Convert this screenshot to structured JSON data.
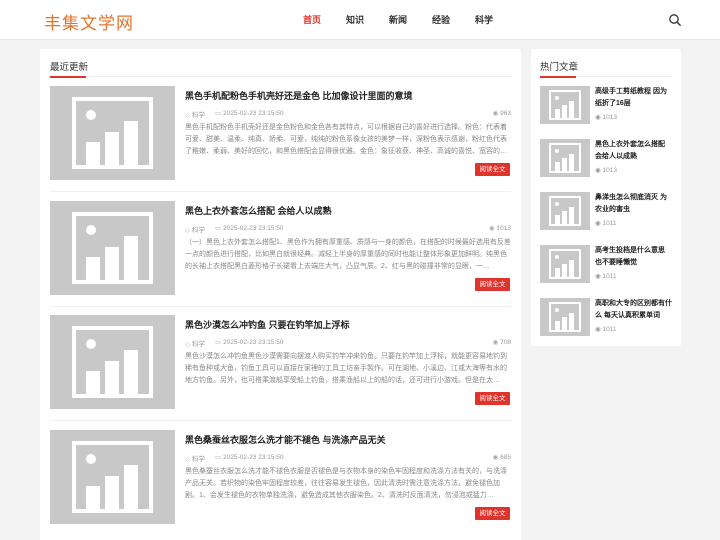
{
  "site": {
    "logo": "丰集文学网"
  },
  "nav": {
    "items": [
      "首页",
      "知识",
      "新闻",
      "经验",
      "科学"
    ],
    "active_index": 0
  },
  "colors": {
    "accent": "#e0332c",
    "logo": "#e2742c"
  },
  "main": {
    "section_title": "最近更新",
    "read_label": "阅读全文",
    "articles": [
      {
        "title": "黑色手机配粉色手机壳好还是金色 比加像设计里面的意境",
        "category": "科学",
        "date": "2025-02-23 23:15:50",
        "views": "963",
        "excerpt": "黑色手机配粉色手机壳好还是金色粉色和金色各有其特点，可以根据自己的喜好进行选择。粉色：代表着可爱、甜美、温柔、纯真、娇柔、可爱，纯纯的粉色系像女孩的美梦一样，深粉色表示感谢，粉红色代表了稚嫩、柔弱、美好的回忆，和黑色搭配会显得很优雅。金色：象征收获、神圣、高诚的喜悦、宽容的…"
      },
      {
        "title": "黑色上衣外套怎么搭配 会给人以成熟",
        "category": "科学",
        "date": "2025-02-23 23:15:50",
        "views": "1013",
        "excerpt": "（一）黑色上衣外套怎么搭配1、黑色作为拥有厚重感、质感与一身的颜色，在搭配的时候最好选用有反差一点的颜色进行搭配，比如黑白就很经典。减轻上半身的厚重感的同时也能让整体形象更加鲜明。纯黑色的长袖上衣搭配黑白菱形格子长裙看上去端庄大气，凸显气质。2、红与黑的碰撞非常的显眼，一…"
      },
      {
        "title": "黑色沙漠怎么冲钓鱼 只要在钓竿加上浮标",
        "category": "科学",
        "date": "2025-02-23 23:15:50",
        "views": "708",
        "excerpt": "黑色沙漠怎么冲钓鱼黑色沙漠需要向摆渡人购买钓竿冲来钓鱼。只要在钓竿加上浮标，就能更容易地钓到稀有鱼种或大鱼，钓鱼工具可以直接在家裡的工具工坊亲手製作。可在湖地、小溪边、江或大海等有水的地方钓鱼。另外，也可搭乘渡船享受船上钓鱼，搭乘渔船以上的船的话，还可进行小游戏。但是在太…"
      },
      {
        "title": "黑色桑蚕丝衣服怎么洗才能不褪色 与洗涤产品无关",
        "category": "科学",
        "date": "2025-02-23 23:15:50",
        "views": "685",
        "excerpt": "黑色桑蚕丝衣服怎么洗才能不褪色衣服是否褪色是与衣物本身的染色牢固程度和洗涤方法有关的，与洗涤产品无关。若织物的染色牢固程度较差，往往容易发生褪色，因此清洗时需注意洗涤方法，避免褪色加剧。1、会发生褪色的衣物单独洗涤，避免造成其他衣服染色。2、清洗时反面清洗，勿浸泡或猛力…"
      }
    ]
  },
  "sidebar": {
    "section_title": "热门文章",
    "items": [
      {
        "title": "高级手工剪纸教程 因为纸折了16层",
        "views": "1013"
      },
      {
        "title": "黑色上衣外套怎么搭配 会给人以成熟",
        "views": "1013"
      },
      {
        "title": "鼻涕虫怎么彻底消灭 为农业的害虫",
        "views": "1011"
      },
      {
        "title": "高考生投档是什么意思 也不要睡懒觉",
        "views": "1011"
      },
      {
        "title": "高职和大专的区别都有什么 每天认真积累单词",
        "views": "1011"
      }
    ]
  }
}
